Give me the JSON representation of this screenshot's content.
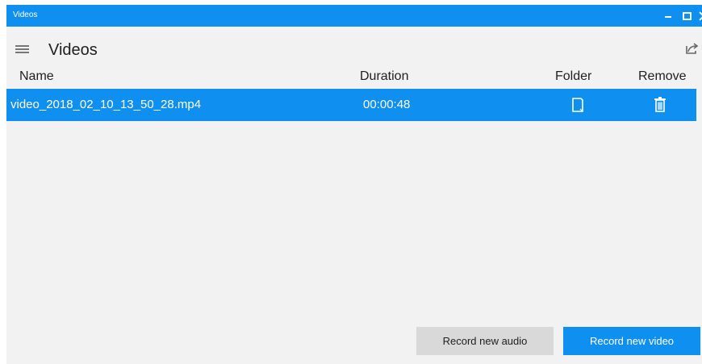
{
  "window": {
    "title": "Videos",
    "controls": {
      "minimize_icon": "minimize-icon",
      "maximize_icon": "maximize-icon",
      "close_icon": "close-icon"
    }
  },
  "header": {
    "menu_icon": "hamburger-menu-icon",
    "title": "Videos",
    "share_icon": "share-icon"
  },
  "table": {
    "columns": [
      "Name",
      "Duration",
      "Folder",
      "Remove"
    ],
    "rows": [
      {
        "name": "video_2018_02_10_13_50_28.mp4",
        "duration": "00:00:48",
        "folder_icon": "folder-icon",
        "remove_icon": "trash-icon",
        "selected": true
      }
    ]
  },
  "actions": {
    "record_audio": "Record new audio",
    "record_video": "Record new video"
  },
  "colors": {
    "accent": "#0f8ff0",
    "background": "#f2f2f2",
    "secondary_button": "#d9d9d9"
  }
}
